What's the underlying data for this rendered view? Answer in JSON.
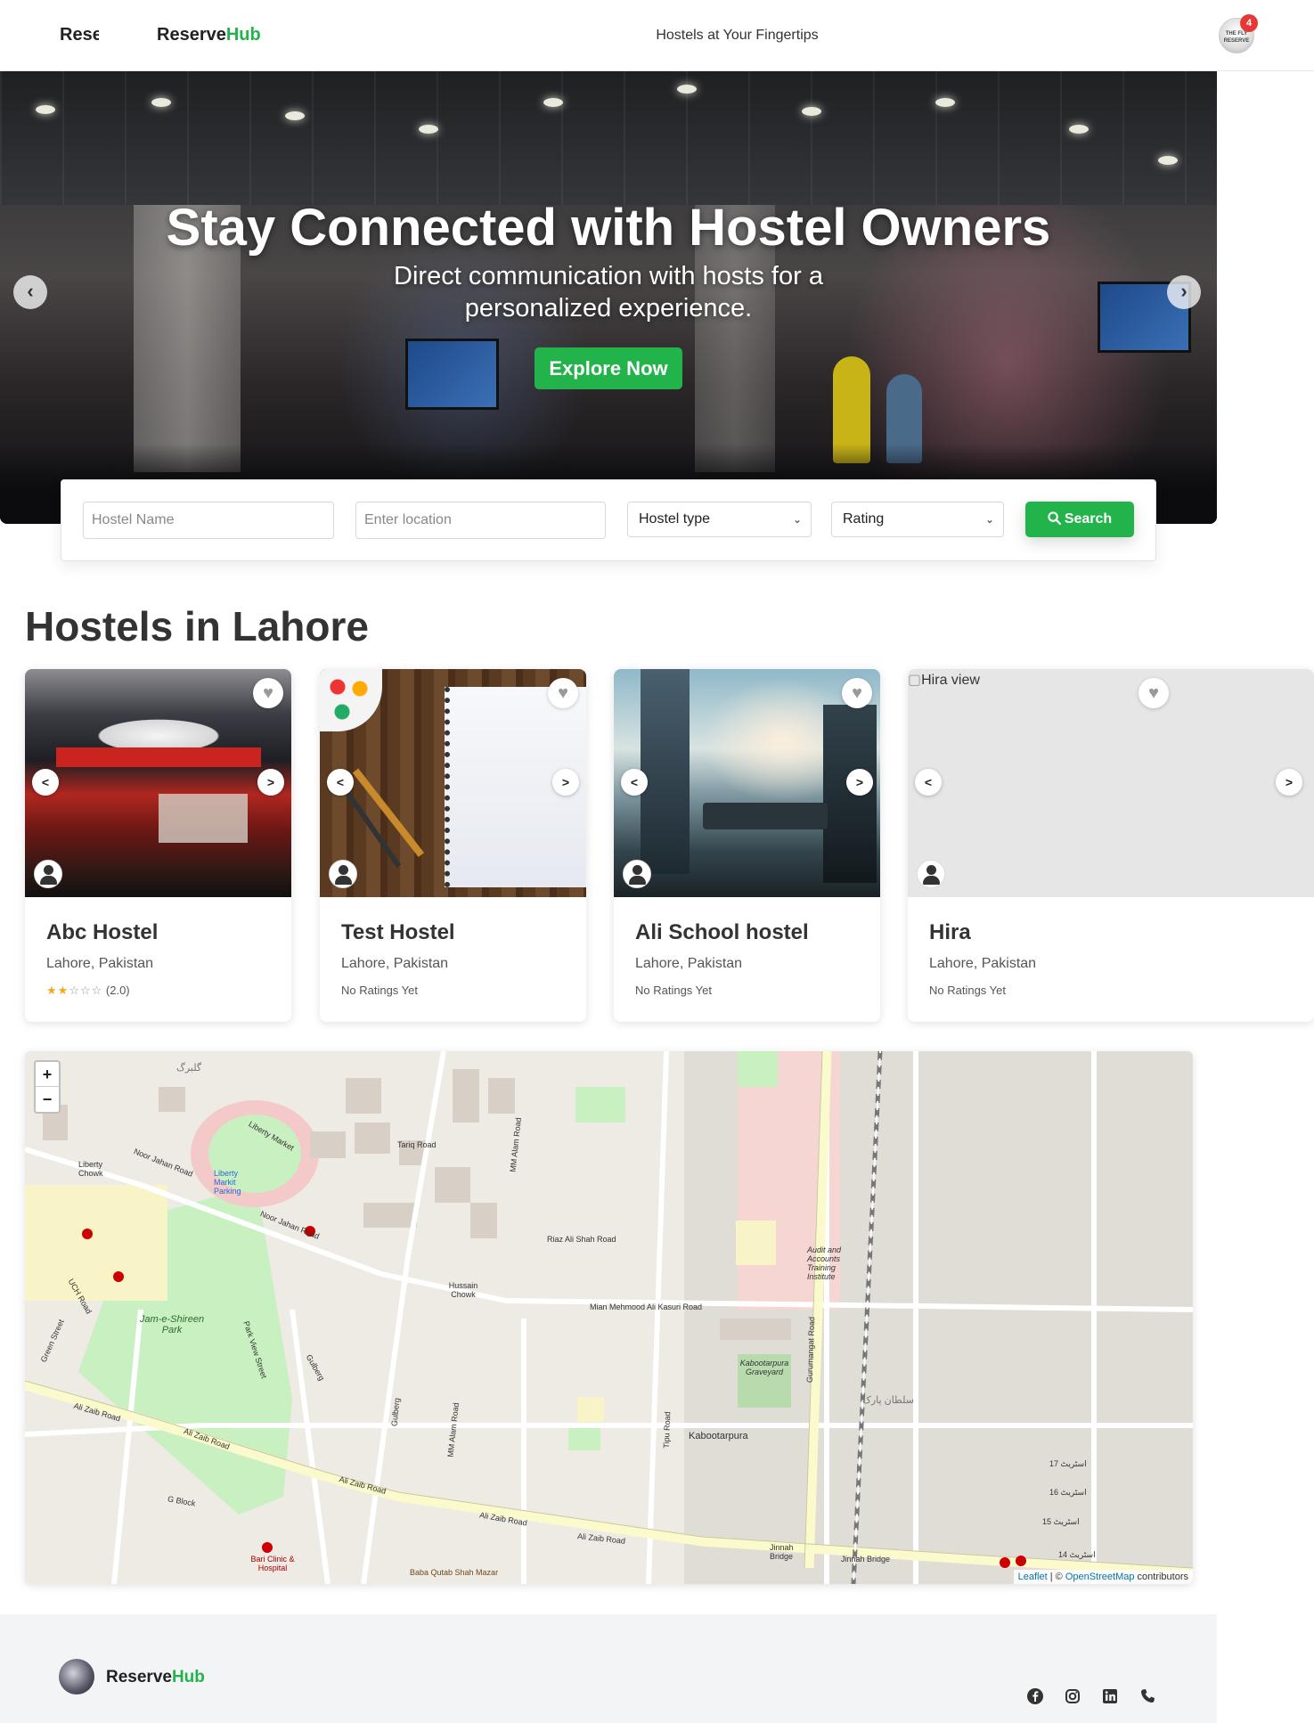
{
  "header": {
    "logo_cut": "Rese",
    "logo_main": "Reserve",
    "logo_accent": "Hub",
    "tagline": "Hostels at Your Fingertips",
    "notification_count": "4",
    "avatar_text": "THE FLY RESERVE"
  },
  "hero": {
    "title": "Stay Connected with Hostel Owners",
    "subtitle": "Direct communication with hosts for a personalized experience.",
    "cta_label": "Explore Now",
    "prev_icon": "chevron-left-icon",
    "next_icon": "chevron-right-icon"
  },
  "search": {
    "name_placeholder": "Hostel Name",
    "location_placeholder": "Enter location",
    "type_selected": "Hostel type",
    "rating_selected": "Rating",
    "button_label": "Search",
    "button_icon": "search-icon",
    "accent_color": "#22b34a"
  },
  "section": {
    "title": "Hostels in Lahore"
  },
  "hostels": [
    {
      "name": "Abc Hostel",
      "location": "Lahore, Pakistan",
      "rating_text": "(2.0)",
      "rating": 2.0,
      "image_alt": ""
    },
    {
      "name": "Test Hostel",
      "location": "Lahore, Pakistan",
      "rating_text": "No Ratings Yet",
      "rating": null,
      "image_alt": ""
    },
    {
      "name": "Ali School hostel",
      "location": "Lahore, Pakistan",
      "rating_text": "No Ratings Yet",
      "rating": null,
      "image_alt": ""
    },
    {
      "name": "Hira",
      "location": "Lahore, Pakistan",
      "rating_text": "No Ratings Yet",
      "rating": null,
      "image_alt": "Hira view"
    }
  ],
  "map": {
    "zoom_in": "+",
    "zoom_out": "−",
    "attribution_leaflet": "Leaflet",
    "attribution_sep": " | © ",
    "attribution_osm": "OpenStreetMap",
    "attribution_tail": " contributors",
    "labels": {
      "ali_zaib_road": "Ali Zaib Road",
      "noor_jahan_road": "Noor Jahan Road",
      "liberty_market": "Liberty Market",
      "liberty_chowk": "Liberty Chowk",
      "liberty_parking": "Liberty Markit Parking",
      "jam_e_shireen_park": "Jam-e-Shireen Park",
      "mm_alam_road": "MM Alam Road",
      "tariq_road": "Tariq Road",
      "riaz_ali_shah_road": "Riaz Ali Shah Road",
      "hussain_chowk": "Hussain Chowk",
      "mian_mehmood_road": "Mian Mehmood Ali Kasuri Road",
      "gurumangat_road": "Gurumangat Road",
      "kabootarpura": "Kabootarpura",
      "kabootarpura_graveyard": "Kabootarpura Graveyard",
      "audit_institute": "Audit and Accounts Training Institute",
      "jinnah_bridge": "Jinnah Bridge",
      "tipu_road": "Tipu Road",
      "g_block": "G Block",
      "bari_clinic": "Bari Clinic & Hospital",
      "baba_qutab": "Baba Qutab Shah Mazar",
      "gulberg": "Gulberg",
      "uch_road": "UCH Road",
      "green_street": "Green Street",
      "park_view_street": "Park View Street",
      "street_17": "17 اسٹریٹ",
      "street_16": "16 اسٹریٹ",
      "street_15": "15 اسٹریٹ",
      "street_14": "14 اسٹریٹ",
      "sultan_park": "سلطان پارک",
      "gulberg_urdu": "گلبرگ"
    }
  },
  "footer": {
    "logo_main": "Reserve",
    "logo_accent": "Hub",
    "social_icons": [
      "facebook-icon",
      "instagram-icon",
      "linkedin-icon",
      "phone-icon"
    ]
  }
}
